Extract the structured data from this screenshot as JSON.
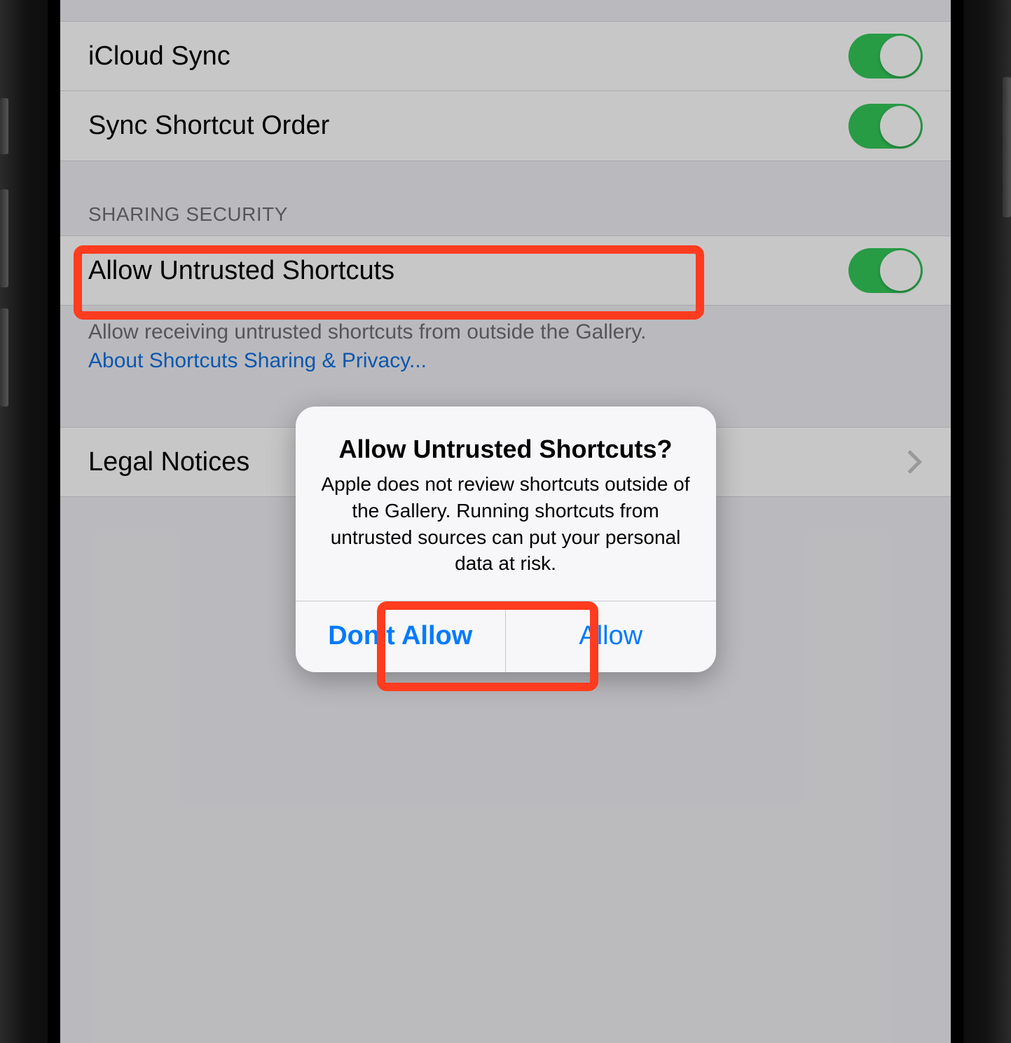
{
  "section1": {
    "row0": {
      "label": "iCloud Sync",
      "on": true
    },
    "row1": {
      "label": "Sync Shortcut Order",
      "on": true
    }
  },
  "section2": {
    "header": "SHARING SECURITY",
    "row0": {
      "label": "Allow Untrusted Shortcuts",
      "on": true
    },
    "footer_text": "Allow receiving untrusted shortcuts from outside the Gallery.",
    "footer_link": "About Shortcuts Sharing & Privacy..."
  },
  "section3": {
    "row0": {
      "label": "Legal Notices"
    }
  },
  "alert": {
    "title": "Allow Untrusted Shortcuts?",
    "message": "Apple does not review shortcuts outside of the Gallery. Running shortcuts from untrusted sources can put your personal data at risk.",
    "buttons": {
      "deny": "Don't Allow",
      "allow": "Allow"
    }
  },
  "colors": {
    "switch_on": "#34c759",
    "accent_blue": "#007aff",
    "highlight_red": "#ff3c1f"
  }
}
